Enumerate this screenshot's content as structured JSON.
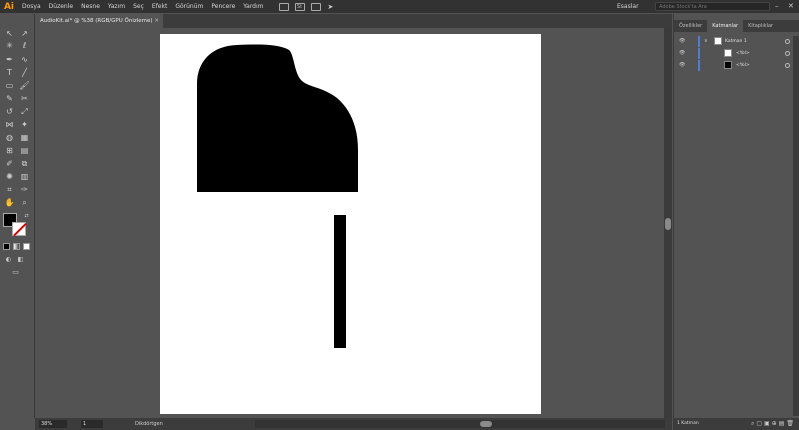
{
  "app": {
    "logo": "Ai",
    "menu": [
      "Dosya",
      "Düzenle",
      "Nesne",
      "Yazım",
      "Seç",
      "Efekt",
      "Görünüm",
      "Pencere",
      "Yardım"
    ],
    "workspace": "Esaslar",
    "search_placeholder": "Adobe Stock'ta Ara"
  },
  "document": {
    "tab_title": "AudioKit.ai* @ %38 (RGB/GPU Önizleme)",
    "close_glyph": "✕"
  },
  "statusbar": {
    "zoom": "38%",
    "page": "1",
    "status_text": "Dikdörtgen"
  },
  "panel": {
    "tabs": [
      "Özellikler",
      "Katmanlar",
      "Kitaplıklar"
    ],
    "active_tab": "Katmanlar",
    "layers": [
      {
        "name": "Katman 1",
        "level": 0
      },
      {
        "name": "<Yol>",
        "level": 1
      },
      {
        "name": "<Yol>",
        "level": 1
      }
    ],
    "footer": "1 Katman"
  },
  "colors": {
    "accent_logo": "#ff9a00",
    "layer_color": "#4f7dd6",
    "fill": "#000000",
    "stroke_none": "#dd0000"
  }
}
